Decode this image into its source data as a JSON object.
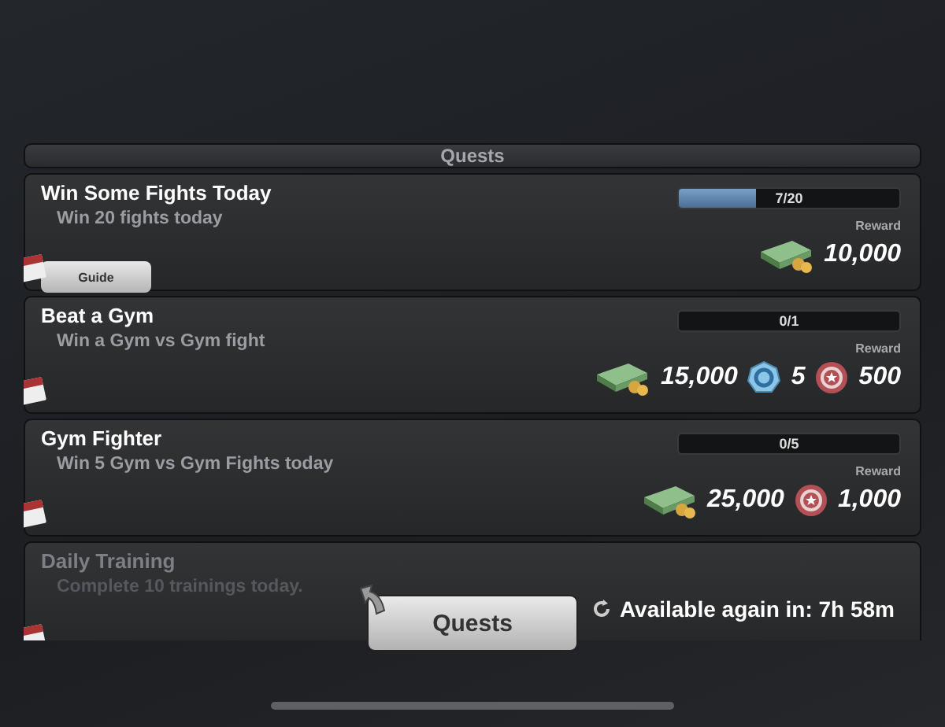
{
  "panel": {
    "title": "Quests"
  },
  "quests": [
    {
      "kind": "active",
      "title": "Win Some Fights Today",
      "description": "Win 20 fights today",
      "progress": "7/20",
      "level": 0.35,
      "reward_label": "Reward",
      "rewards": [
        {
          "kind": "cash",
          "amount": "10,000"
        }
      ],
      "guide": "Guide"
    },
    {
      "kind": "active",
      "title": "Beat a Gym",
      "description": "Win a Gym vs Gym fight",
      "progress": "0/1",
      "reward_label": "Reward",
      "rewards": [
        {
          "kind": "cash",
          "amount": "15,000"
        },
        {
          "kind": "coin",
          "amount": "5"
        },
        {
          "kind": "token",
          "amount": "500"
        }
      ]
    },
    {
      "kind": "active",
      "title": "Gym Fighter",
      "description": "Win 5 Gym vs Gym Fights today",
      "progress": "0/5",
      "reward_label": "Reward",
      "rewards": [
        {
          "kind": "cash",
          "amount": "25,000"
        },
        {
          "kind": "token",
          "amount": "1,000"
        }
      ]
    },
    {
      "kind": "cooldown",
      "title": "Daily Training",
      "description": "Complete 10 trainings today.",
      "availability": "Available again in:  7h 58m"
    }
  ],
  "quests_button": "Quests"
}
